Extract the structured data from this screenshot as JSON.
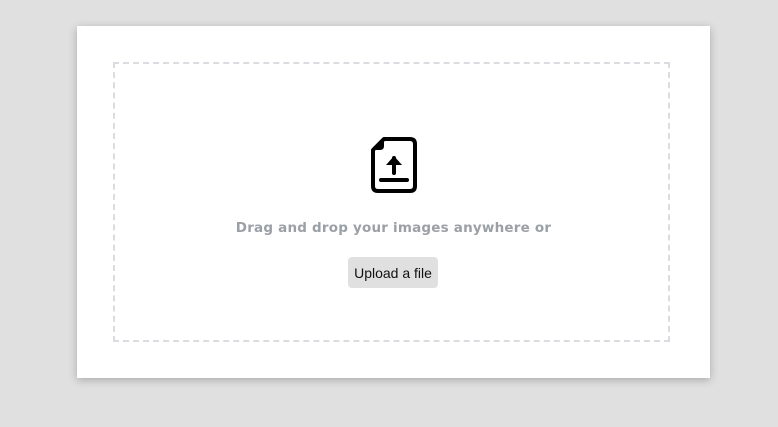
{
  "upload": {
    "icon": "file-upload-icon",
    "prompt": "Drag and drop your images anywhere or",
    "button_label": "Upload a file"
  },
  "colors": {
    "background": "#e0e0e0",
    "card": "#ffffff",
    "dashed_border": "#dadce0",
    "prompt_text": "#9aa0a6",
    "button_bg": "#e0e0e0"
  }
}
